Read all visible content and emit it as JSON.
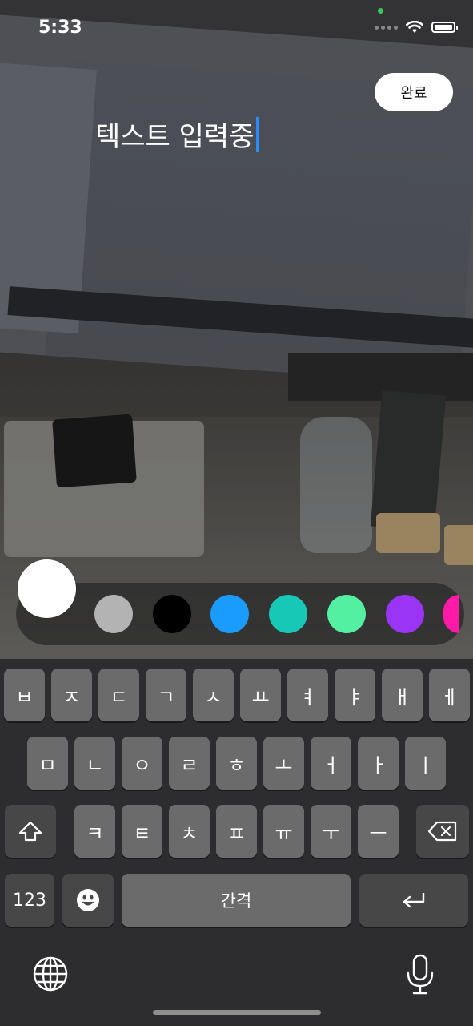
{
  "status": {
    "time": "5:33"
  },
  "done_button": {
    "label": "완료"
  },
  "text_entry": {
    "value": "텍스트 입력중"
  },
  "palette": {
    "selected": "#ffffff",
    "colors": [
      "#b3b3b3",
      "#000000",
      "#1a9cff",
      "#17c8b6",
      "#52f0a0",
      "#9b35f5",
      "#ff1aa8"
    ]
  },
  "keyboard": {
    "row1": [
      "ㅂ",
      "ㅈ",
      "ㄷ",
      "ㄱ",
      "ㅅ",
      "ㅛ",
      "ㅕ",
      "ㅑ",
      "ㅐ",
      "ㅔ"
    ],
    "row2": [
      "ㅁ",
      "ㄴ",
      "ㅇ",
      "ㄹ",
      "ㅎ",
      "ㅗ",
      "ㅓ",
      "ㅏ",
      "ㅣ"
    ],
    "row3": [
      "ㅋ",
      "ㅌ",
      "ㅊ",
      "ㅍ",
      "ㅠ",
      "ㅜ",
      "ㅡ"
    ],
    "numbers_key": "123",
    "space_key": "간격"
  },
  "icons": {
    "shift": "shift-icon",
    "delete": "backspace-icon",
    "emoji": "emoji-icon",
    "return": "return-icon",
    "globe": "globe-icon",
    "mic": "microphone-icon"
  }
}
